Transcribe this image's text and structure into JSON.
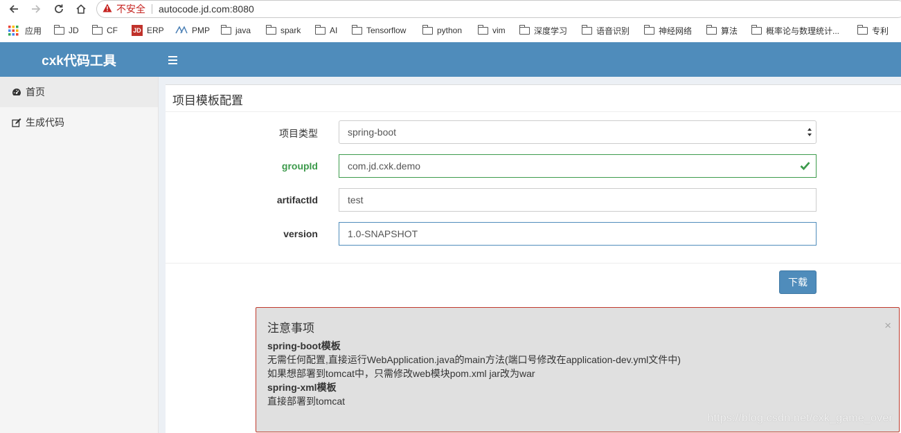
{
  "browser": {
    "insecure_label": "不安全",
    "url": "autocode.jd.com:8080",
    "bookmarks": [
      "应用",
      "JD",
      "CF",
      "ERP",
      "PMP",
      "java",
      "spark",
      "AI",
      "Tensorflow",
      "python",
      "vim",
      "深度学习",
      "语音识别",
      "神经网络",
      "算法",
      "概率论与数理统计...",
      "专利"
    ]
  },
  "app": {
    "title": "cxk代码工具"
  },
  "sidebar": {
    "items": [
      {
        "label": "首页",
        "icon": "dashboard-icon"
      },
      {
        "label": "生成代码",
        "icon": "edit-icon"
      }
    ]
  },
  "panel": {
    "title": "项目模板配置",
    "fields": {
      "type": {
        "label": "项目类型",
        "value": "spring-boot"
      },
      "groupId": {
        "label": "groupId",
        "value": "com.jd.cxk.demo"
      },
      "artifactId": {
        "label": "artifactId",
        "value": "test"
      },
      "version": {
        "label": "version",
        "value": "1.0-SNAPSHOT"
      }
    },
    "download_label": "下载"
  },
  "notice": {
    "title": "注意事项",
    "close": "×",
    "lines": [
      "spring-boot模板",
      "无需任何配置,直接运行WebApplication.java的main方法(端口号修改在application-dev.yml文件中)",
      "如果想部署到tomcat中，只需修改web模块pom.xml jar改为war",
      "spring-xml模板",
      "直接部署到tomcat"
    ]
  },
  "watermark": "https://blog.csdn.net/cxk_game_over",
  "colors": {
    "header": "#4f8cbb",
    "success": "#3c9a4b",
    "notice_border": "#c0392b"
  }
}
